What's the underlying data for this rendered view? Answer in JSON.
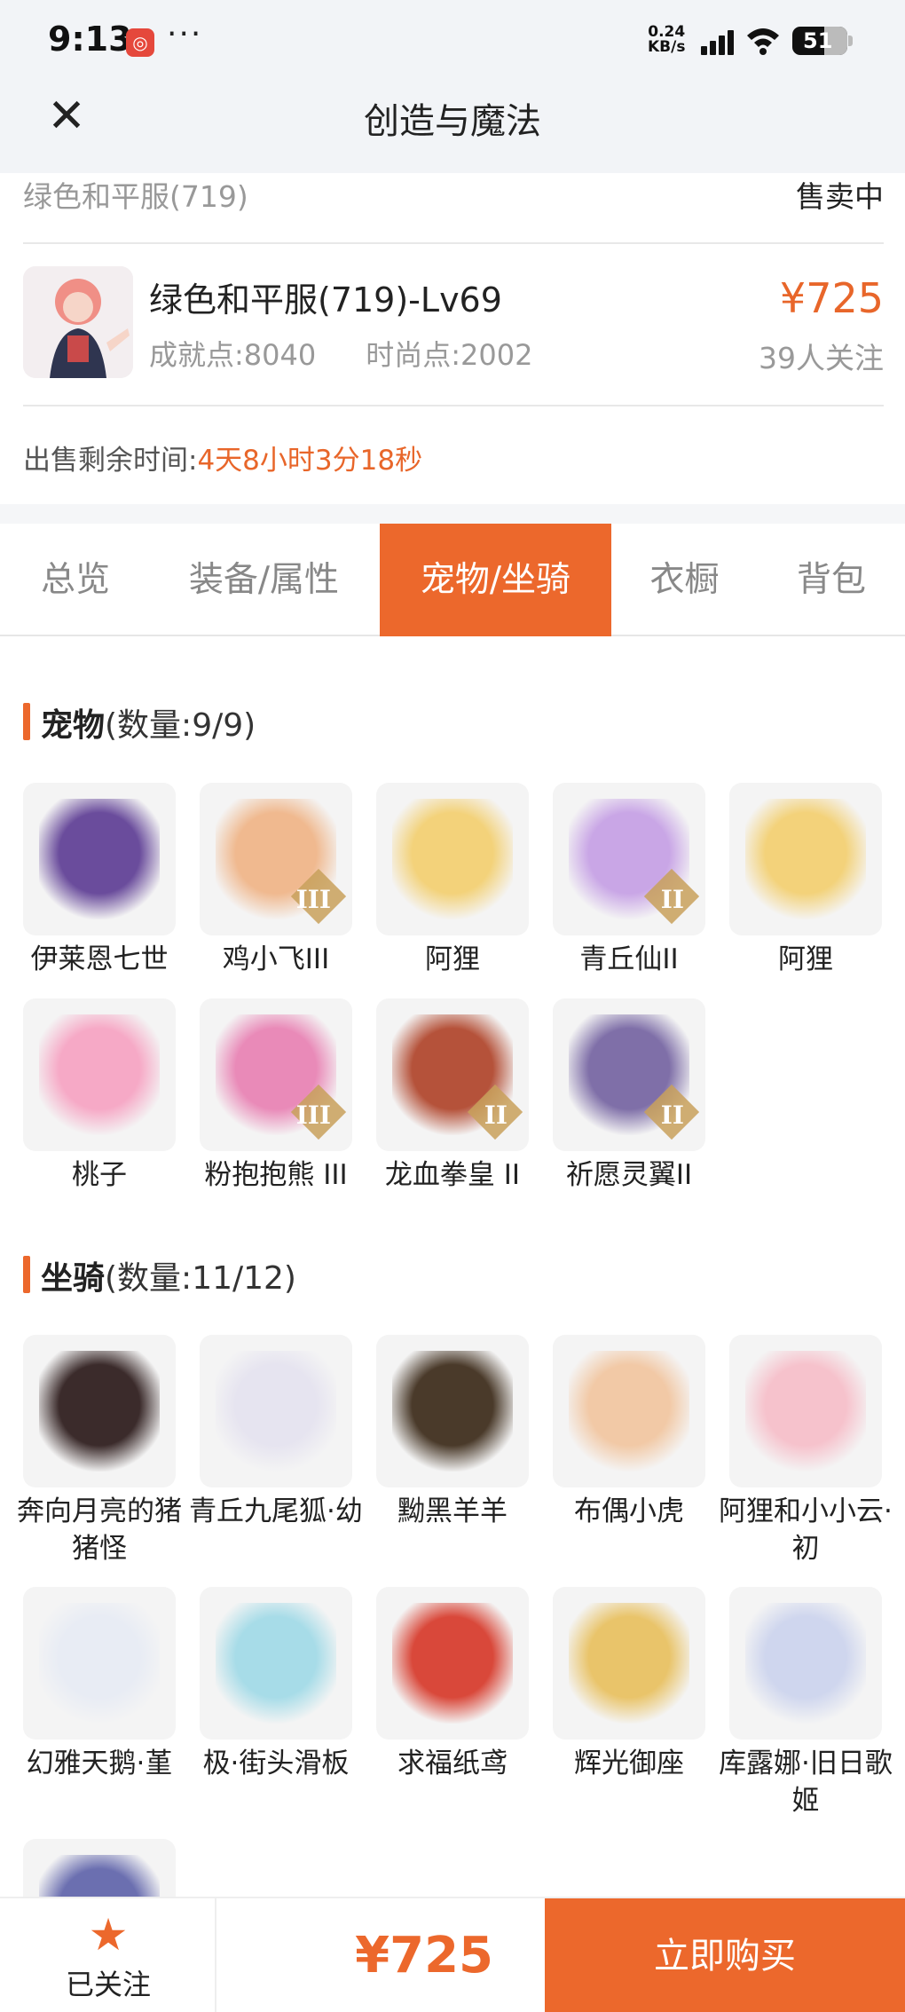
{
  "status_bar": {
    "time": "9:13",
    "app_badge": "◎",
    "speed_value": "0.24",
    "speed_unit": "KB/s",
    "battery": "51"
  },
  "header": {
    "title": "创造与魔法",
    "close_icon": "close-icon"
  },
  "account": {
    "server": "绿色和平服(719)",
    "sale_status": "售卖中",
    "name": "绿色和平服(719)-Lv69",
    "achievement": "成就点:8040",
    "fashion": "时尚点:2002",
    "price": "¥725",
    "followers": "39人关注",
    "remaining_label": "出售剩余时间:",
    "remaining_value": "4天8小时3分18秒"
  },
  "tabs": [
    {
      "label": "总览",
      "active": false
    },
    {
      "label": "装备/属性",
      "active": false
    },
    {
      "label": "宠物/坐骑",
      "active": true
    },
    {
      "label": "衣橱",
      "active": false
    },
    {
      "label": "背包",
      "active": false
    }
  ],
  "pets": {
    "title": "宠物",
    "count": "(数量:9/9)",
    "items": [
      {
        "name": "伊莱恩七世",
        "tier": "",
        "color": "#6a4c9c"
      },
      {
        "name": "鸡小飞III",
        "tier": "III",
        "color": "#f0b98f"
      },
      {
        "name": "阿狸",
        "tier": "",
        "color": "#f3d27a"
      },
      {
        "name": "青丘仙II",
        "tier": "II",
        "color": "#c9a6e6"
      },
      {
        "name": "阿狸",
        "tier": "",
        "color": "#f3d27a"
      },
      {
        "name": "桃子",
        "tier": "",
        "color": "#f6a9c6"
      },
      {
        "name": "粉抱抱熊 III",
        "tier": "III",
        "color": "#e98ab8"
      },
      {
        "name": "龙血拳皇 II",
        "tier": "II",
        "color": "#b5523a"
      },
      {
        "name": "祈愿灵翼II",
        "tier": "II",
        "color": "#7f6fa8"
      }
    ]
  },
  "mounts": {
    "title": "坐骑",
    "count": "(数量:11/12)",
    "items": [
      {
        "name": "奔向月亮的猪猪怪",
        "tier": "",
        "color": "#3b2b2b"
      },
      {
        "name": "青丘九尾狐·幼",
        "tier": "",
        "color": "#e6e4f0"
      },
      {
        "name": "黝黑羊羊",
        "tier": "",
        "color": "#4a3a2a"
      },
      {
        "name": "布偶小虎",
        "tier": "",
        "color": "#f2c9a6"
      },
      {
        "name": "阿狸和小小云·初",
        "tier": "",
        "color": "#f6c2cc"
      },
      {
        "name": "幻雅天鹅·堇",
        "tier": "",
        "color": "#e8ecf4"
      },
      {
        "name": "极·街头滑板",
        "tier": "",
        "color": "#a7dce8"
      },
      {
        "name": "求福纸鸢",
        "tier": "",
        "color": "#d9483a"
      },
      {
        "name": "辉光御座",
        "tier": "",
        "color": "#e9c46a"
      },
      {
        "name": "库露娜·旧日歌姬",
        "tier": "",
        "color": "#cfd6ee"
      },
      {
        "name": "",
        "tier": "",
        "color": "#6b6fb0"
      }
    ]
  },
  "bottom": {
    "follow_label": "已关注",
    "price": "¥725",
    "buy_label": "立即购买"
  },
  "colors": {
    "accent": "#ec682c"
  }
}
